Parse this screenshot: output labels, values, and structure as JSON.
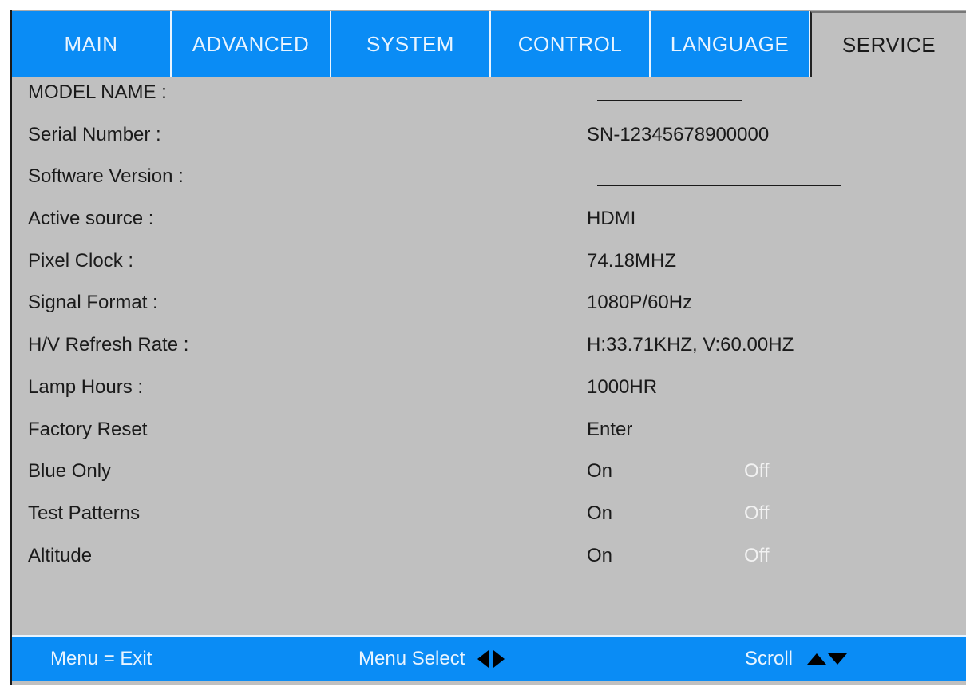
{
  "tabs": [
    {
      "label": "MAIN"
    },
    {
      "label": "ADVANCED"
    },
    {
      "label": "SYSTEM"
    },
    {
      "label": "CONTROL"
    },
    {
      "label": "LANGUAGE"
    },
    {
      "label": "SERVICE",
      "active": true
    }
  ],
  "info": {
    "model_name": {
      "label": "MODEL NAME :",
      "value": ""
    },
    "serial_number": {
      "label": "Serial Number :",
      "value": "SN-12345678900000"
    },
    "software_version": {
      "label": "Software Version :",
      "value": ""
    },
    "active_source": {
      "label": "Active source :",
      "value": "HDMI"
    },
    "pixel_clock": {
      "label": "Pixel Clock :",
      "value": "74.18MHZ"
    },
    "signal_format": {
      "label": "Signal Format :",
      "value": "1080P/60Hz"
    },
    "refresh_rate": {
      "label": "H/V Refresh Rate :",
      "value": "H:33.71KHZ, V:60.00HZ"
    },
    "lamp_hours": {
      "label": "Lamp Hours :",
      "value": "1000HR"
    }
  },
  "actions": {
    "factory_reset": {
      "label": "Factory Reset",
      "value": "Enter"
    },
    "blue_only": {
      "label": "Blue Only",
      "on": "On",
      "off": "Off",
      "selected": "On"
    },
    "test_patterns": {
      "label": "Test Patterns",
      "on": "On",
      "off": "Off",
      "selected": "On"
    },
    "altitude": {
      "label": "Altitude",
      "on": "On",
      "off": "Off",
      "selected": "On"
    }
  },
  "footer": {
    "exit": "Menu = Exit",
    "menu_select": "Menu Select",
    "scroll": "Scroll"
  },
  "colors": {
    "tab_bar": "#0a8cf5",
    "panel": "#c0c0c0",
    "unselected_option": "#f2f2f2"
  }
}
